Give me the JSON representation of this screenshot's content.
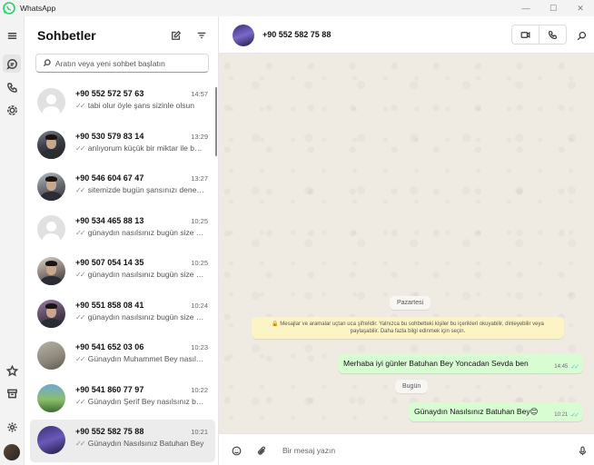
{
  "window": {
    "title": "WhatsApp",
    "minimize": "—",
    "maximize": "☐",
    "close": "✕"
  },
  "sidebar": {
    "title": "Sohbetler",
    "search_placeholder": "Aratın veya yeni sohbet başlatın"
  },
  "chats": [
    {
      "name": "+90 552 572 57 63",
      "time": "14:57",
      "preview": "tabi olur öyle şans sizinle olsun",
      "avatar": "default"
    },
    {
      "name": "+90 530 579 83 14",
      "time": "13:29",
      "preview": "anlıyorum küçük bir miktar ile başlayabiliriz",
      "avatar": "photo"
    },
    {
      "name": "+90 546 604 67 47",
      "time": "13:27",
      "preview": "sitemizde bugün şansınızı deneyin",
      "avatar": "photo"
    },
    {
      "name": "+90 534 465 88 13",
      "time": "10:25",
      "preview": "günaydın nasılsınız bugün size nasıl",
      "avatar": "default"
    },
    {
      "name": "+90 507 054 14 35",
      "time": "10:25",
      "preview": "günaydın nasılsınız bugün size nasıl",
      "avatar": "photo"
    },
    {
      "name": "+90 551 858 08 41",
      "time": "10:24",
      "preview": "günaydın nasılsınız bugün size nasıl",
      "avatar": "photo"
    },
    {
      "name": "+90 541 652 03 06",
      "time": "10:23",
      "preview": "Günaydın Muhammet Bey nasılsınız",
      "avatar": "wall"
    },
    {
      "name": "+90 541 860 77 97",
      "time": "10:22",
      "preview": "Günaydın Şerif Bey nasılsınız bugün",
      "avatar": "outdoor"
    },
    {
      "name": "+90 552 582 75 88",
      "time": "10:21",
      "preview": "Günaydın Nasılsınız Batuhan Bey",
      "avatar": "purple",
      "selected": true
    }
  ],
  "conversation": {
    "contact": "+90 552 582 75 88",
    "date_1": "Pazartesi",
    "encryption_notice": "🔒 Mesajlar ve aramalar uçtan uca şifrelidir. Yalnızca bu sohbetteki kişiler bu içerikleri okuyabilir, dinleyebilir veya paylaşabilir. Daha fazla bilgi edinmek için seçin.",
    "message_1": {
      "text": "Merhaba iyi günler  Batuhan Bey Yoncadan  Sevda ben",
      "time": "14:45"
    },
    "date_2": "Bugün",
    "message_2": {
      "text": "Günaydın Nasılsınız Batuhan Bey😊",
      "time": "10:21"
    },
    "composer_placeholder": "Bir mesaj yazın"
  }
}
